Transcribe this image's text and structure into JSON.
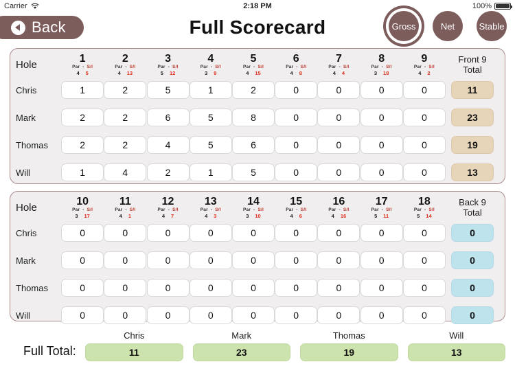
{
  "status_bar": {
    "carrier": "Carrier",
    "wifi_icon": "wifi-icon",
    "time": "2:18 PM",
    "battery_percent": "100%",
    "battery_icon": "battery-full-icon"
  },
  "nav": {
    "back_label": "Back",
    "back_icon": "back-arrow-icon",
    "title": "Full Scorecard",
    "modes": [
      {
        "label": "Gross",
        "selected": true
      },
      {
        "label": "Net",
        "selected": false
      },
      {
        "label": "Stable",
        "selected": false
      }
    ]
  },
  "labels": {
    "hole": "Hole",
    "par_si": "Par  -  S/I",
    "par_word": "Par",
    "si_word": "S/I",
    "dash": "-",
    "front_total": "Front 9\nTotal",
    "front_total_line1": "Front 9",
    "front_total_line2": "Total",
    "back_total_line1": "Back 9",
    "back_total_line2": "Total",
    "full_total": "Full Total:"
  },
  "colors": {
    "brand": "#7d5c5c",
    "card_bg": "#f0eeee",
    "card_border": "#a98a8a",
    "front_total_bg": "#e6d5b9",
    "back_total_bg": "#bfe3ed",
    "full_total_bg": "#cde3ae",
    "si_text": "#e0301e"
  },
  "players": [
    "Chris",
    "Mark",
    "Thomas",
    "Will"
  ],
  "front_nine": {
    "holes": [
      {
        "number": "1",
        "par": "4",
        "si": "5"
      },
      {
        "number": "2",
        "par": "4",
        "si": "13"
      },
      {
        "number": "3",
        "par": "5",
        "si": "12"
      },
      {
        "number": "4",
        "par": "3",
        "si": "9"
      },
      {
        "number": "5",
        "par": "4",
        "si": "15"
      },
      {
        "number": "6",
        "par": "4",
        "si": "8"
      },
      {
        "number": "7",
        "par": "4",
        "si": "4"
      },
      {
        "number": "8",
        "par": "3",
        "si": "18"
      },
      {
        "number": "9",
        "par": "4",
        "si": "2"
      }
    ],
    "rows": [
      {
        "player": "Chris",
        "scores": [
          "1",
          "2",
          "5",
          "1",
          "2",
          "0",
          "0",
          "0",
          "0"
        ],
        "total": "11"
      },
      {
        "player": "Mark",
        "scores": [
          "2",
          "2",
          "6",
          "5",
          "8",
          "0",
          "0",
          "0",
          "0"
        ],
        "total": "23"
      },
      {
        "player": "Thomas",
        "scores": [
          "2",
          "2",
          "4",
          "5",
          "6",
          "0",
          "0",
          "0",
          "0"
        ],
        "total": "19"
      },
      {
        "player": "Will",
        "scores": [
          "1",
          "4",
          "2",
          "1",
          "5",
          "0",
          "0",
          "0",
          "0"
        ],
        "total": "13"
      }
    ]
  },
  "back_nine": {
    "holes": [
      {
        "number": "10",
        "par": "3",
        "si": "17"
      },
      {
        "number": "11",
        "par": "4",
        "si": "1"
      },
      {
        "number": "12",
        "par": "4",
        "si": "7"
      },
      {
        "number": "13",
        "par": "4",
        "si": "3"
      },
      {
        "number": "14",
        "par": "3",
        "si": "10"
      },
      {
        "number": "15",
        "par": "4",
        "si": "6"
      },
      {
        "number": "16",
        "par": "4",
        "si": "16"
      },
      {
        "number": "17",
        "par": "5",
        "si": "11"
      },
      {
        "number": "18",
        "par": "5",
        "si": "14"
      }
    ],
    "rows": [
      {
        "player": "Chris",
        "scores": [
          "0",
          "0",
          "0",
          "0",
          "0",
          "0",
          "0",
          "0",
          "0"
        ],
        "total": "0"
      },
      {
        "player": "Mark",
        "scores": [
          "0",
          "0",
          "0",
          "0",
          "0",
          "0",
          "0",
          "0",
          "0"
        ],
        "total": "0"
      },
      {
        "player": "Thomas",
        "scores": [
          "0",
          "0",
          "0",
          "0",
          "0",
          "0",
          "0",
          "0",
          "0"
        ],
        "total": "0"
      },
      {
        "player": "Will",
        "scores": [
          "0",
          "0",
          "0",
          "0",
          "0",
          "0",
          "0",
          "0",
          "0"
        ],
        "total": "0"
      }
    ]
  },
  "footer": {
    "label": "Full Total:",
    "columns": [
      {
        "name": "Chris",
        "total": "11"
      },
      {
        "name": "Mark",
        "total": "23"
      },
      {
        "name": "Thomas",
        "total": "19"
      },
      {
        "name": "Will",
        "total": "13"
      }
    ]
  }
}
